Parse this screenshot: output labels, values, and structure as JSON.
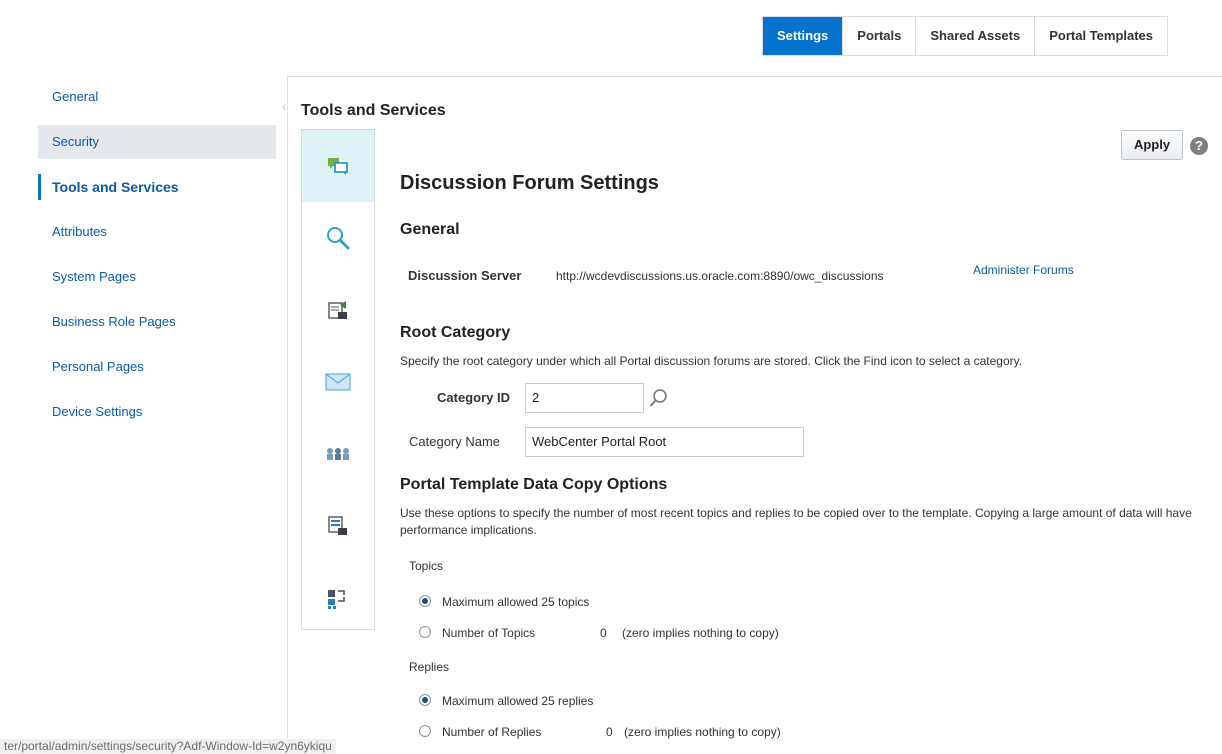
{
  "top_tabs": [
    {
      "label": "Settings"
    },
    {
      "label": "Portals"
    },
    {
      "label": "Shared Assets"
    },
    {
      "label": "Portal Templates"
    }
  ],
  "left_nav": [
    {
      "label": "General"
    },
    {
      "label": "Security"
    },
    {
      "label": "Tools and Services"
    },
    {
      "label": "Attributes"
    },
    {
      "label": "System Pages"
    },
    {
      "label": "Business Role Pages"
    },
    {
      "label": "Personal Pages"
    },
    {
      "label": "Device Settings"
    }
  ],
  "section_title": "Tools and Services",
  "strip_icons": [
    "discussion-icon",
    "search-icon",
    "document-upload-icon",
    "mail-icon",
    "people-connections-icon",
    "document-list-icon",
    "workflow-icon"
  ],
  "apply_label": "Apply",
  "help_label": "?",
  "form": {
    "title": "Discussion Forum Settings",
    "general_heading": "General",
    "server_label": "Discussion Server",
    "server_value": "http://wcdevdiscussions.us.oracle.com:8890/owc_discussions",
    "administer_link": "Administer Forums",
    "root_heading": "Root Category",
    "root_desc": "Specify the root category under which all Portal discussion forums are stored. Click the Find icon to select a category.",
    "category_id_label": "Category ID",
    "category_id_value": "2",
    "category_name_label": "Category Name",
    "category_name_value": "WebCenter Portal Root",
    "copy_heading": "Portal Template Data Copy Options",
    "copy_desc": "Use these options to specify the number of most recent topics and replies to be copied over to the template. Copying a large amount of data will have performance implications.",
    "topics_label": "Topics",
    "topics_max": "Maximum allowed 25 topics",
    "topics_number": "Number of Topics",
    "topics_count": "0",
    "topics_note": "(zero implies nothing to copy)",
    "replies_label": "Replies",
    "replies_max": "Maximum allowed 25 replies",
    "replies_number": "Number of Replies",
    "replies_count": "0",
    "replies_note": "(zero implies nothing to copy)"
  },
  "status_url": "ter/portal/admin/settings/security?Adf-Window-Id=w2yn6ykiqu",
  "colors": {
    "accent": "#0572ce",
    "link": "#0b5aa8",
    "selected_nav_bg": "#e4e8ed",
    "active_icon_bg": "#dff2f8"
  }
}
